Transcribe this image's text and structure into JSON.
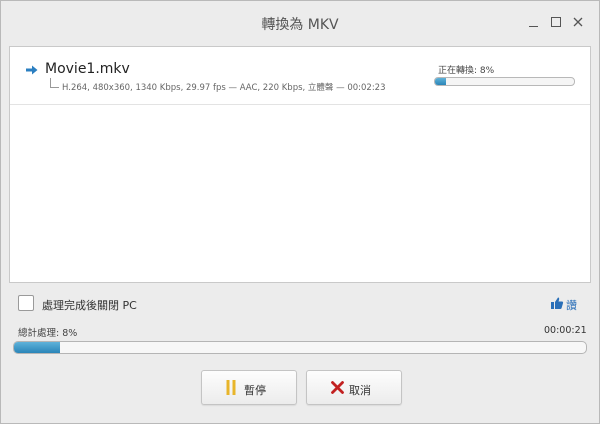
{
  "window": {
    "title": "轉換為 MKV"
  },
  "file": {
    "name": "Movie1.mkv",
    "info": "H.264, 480x360, 1340 Kbps, 29.97 fps — AAC, 220 Kbps, 立體聲 — 00:02:23",
    "status": "正在轉換: 8%",
    "progress_percent": 8
  },
  "options": {
    "shutdown_label": "處理完成後關閉 PC",
    "shutdown_checked": false,
    "like_label": "讚"
  },
  "total": {
    "label": "總計處理: 8%",
    "elapsed": "00:00:21",
    "progress_percent": 8
  },
  "buttons": {
    "pause_label": "暫停",
    "cancel_label": "取消"
  },
  "colors": {
    "progress_fill": "#2a85b8",
    "arrow": "#2b7fc1",
    "pause_icon": "#e8b52a",
    "cancel_icon": "#c22121",
    "like": "#2a6fb8"
  }
}
